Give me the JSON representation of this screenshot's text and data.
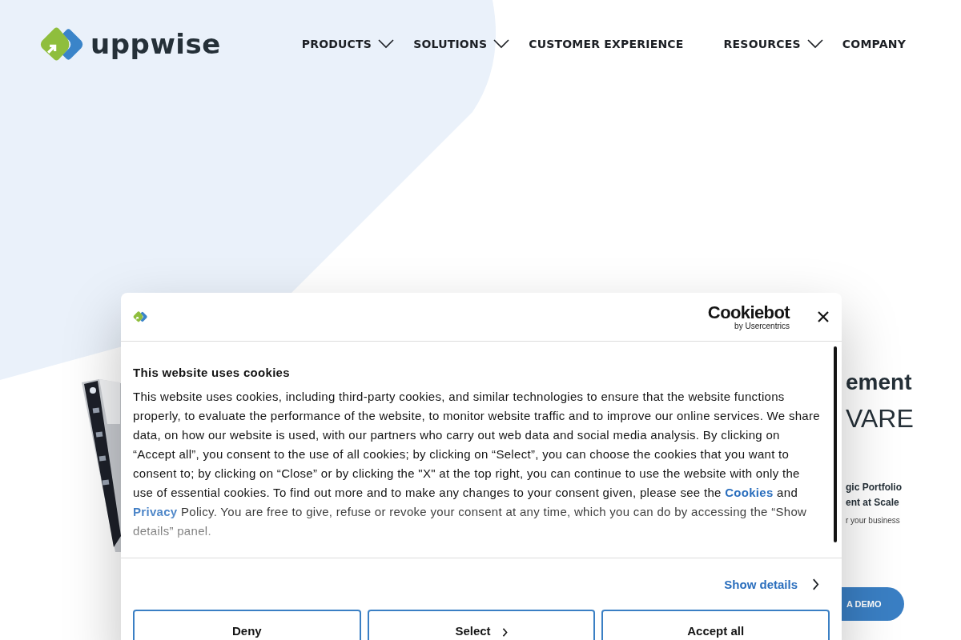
{
  "header": {
    "logo_text": "uppwise",
    "nav": [
      {
        "label": "PRODUCTS",
        "dropdown": true
      },
      {
        "label": "SOLUTIONS",
        "dropdown": true
      },
      {
        "label": "CUSTOMER EXPERIENCE",
        "dropdown": false
      },
      {
        "label": "RESOURCES",
        "dropdown": true
      },
      {
        "label": "COMPANY",
        "dropdown": false
      }
    ]
  },
  "hero": {
    "kind": "picture",
    "title_fragment": "ement",
    "subtitle_fragment": "VARE",
    "lines": [
      "gic Portfolio",
      "ent at Scale"
    ],
    "caption_fragment": "r your business",
    "button": "A DEMO"
  },
  "cookie_dialog": {
    "brand": "Cookiebot",
    "brand_sub": "by Usercentrics",
    "title": "This website uses cookies",
    "body": [
      {
        "kind": "text",
        "text": "This website uses cookies, including third-party cookies, and similar technologies to ensure that the website functions properly, to evaluate the performance of the website, to monitor website traffic and to improve our online services. We share data, on how our website is used, with our partners who carry out web data and social media analysis. By clicking on “Accept all”, you consent to the use of all cookies; by clicking on “Select”, you can choose the cookies that you want to consent to; by clicking on “Close” or by clicking the \"X\" at the top right, you can continue to use the website with only the use of essential cookies. To find out more and to make any changes to your consent given, please see the "
      },
      {
        "kind": "link",
        "text": "Cookies"
      },
      {
        "kind": "text",
        "text": " and "
      },
      {
        "kind": "link",
        "text": "Privacy"
      },
      {
        "kind": "text",
        "text": " Policy. You are free to give, refuse or revoke your consent at any time, which you can do by accessing the “Show details” panel."
      }
    ],
    "show_details": "Show details",
    "buttons": [
      {
        "label": "Deny",
        "chevron": false
      },
      {
        "label": "Select",
        "chevron": true
      },
      {
        "label": "Accept all",
        "chevron": false
      }
    ]
  }
}
